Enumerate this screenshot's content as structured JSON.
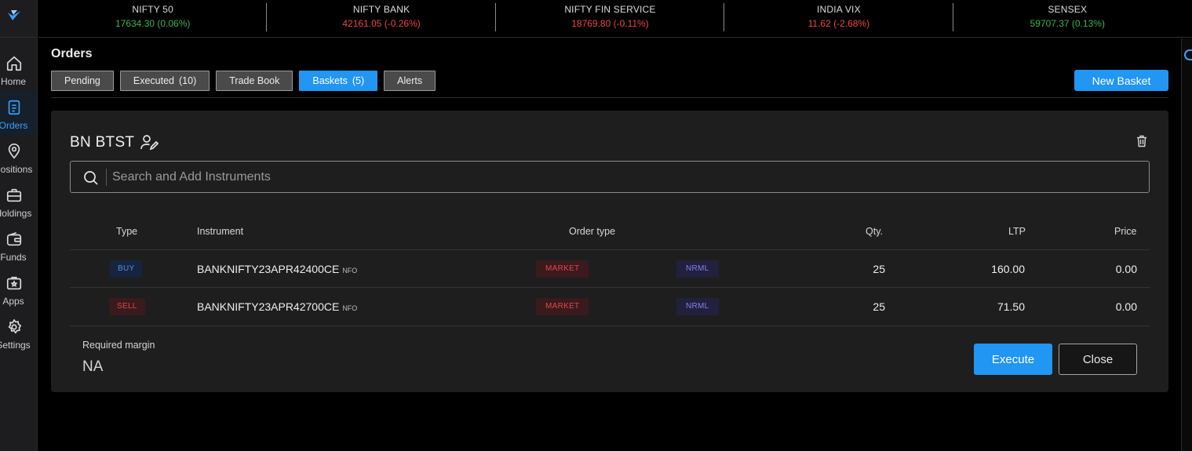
{
  "sidebar": {
    "items": [
      {
        "label": "Home",
        "icon": "home-icon"
      },
      {
        "label": "Orders",
        "icon": "orders-icon",
        "active": true
      },
      {
        "label": "Positions",
        "icon": "location-pin-icon"
      },
      {
        "label": "Holdings",
        "icon": "briefcase-icon"
      },
      {
        "label": "Funds",
        "icon": "wallet-icon"
      },
      {
        "label": "Apps",
        "icon": "apps-icon"
      },
      {
        "label": "Settings",
        "icon": "gear-icon"
      }
    ]
  },
  "ticker": [
    {
      "name": "NIFTY 50",
      "value": "17634.30 (0.06%)",
      "trend": "up"
    },
    {
      "name": "NIFTY BANK",
      "value": "42161.05 (-0.26%)",
      "trend": "down"
    },
    {
      "name": "NIFTY FIN SERVICE",
      "value": "18769.80 (-0.11%)",
      "trend": "down"
    },
    {
      "name": "INDIA VIX",
      "value": "11.62 (-2.68%)",
      "trend": "down"
    },
    {
      "name": "SENSEX",
      "value": "59707.37 (0.13%)",
      "trend": "up"
    }
  ],
  "page": {
    "title": "Orders",
    "new_basket_label": "New Basket"
  },
  "tabs": [
    {
      "label": "Pending",
      "count": ""
    },
    {
      "label": "Executed",
      "count": "(10)"
    },
    {
      "label": "Trade Book",
      "count": ""
    },
    {
      "label": "Baskets",
      "count": "(5)",
      "active": true
    },
    {
      "label": "Alerts",
      "count": ""
    }
  ],
  "basket": {
    "name": "BN BTST",
    "search_placeholder": "Search and Add Instruments",
    "columns": {
      "type": "Type",
      "instrument": "Instrument",
      "order_type": "Order type",
      "qty": "Qty.",
      "ltp": "LTP",
      "price": "Price"
    },
    "rows": [
      {
        "type": "BUY",
        "instrument": "BANKNIFTY23APR42400CE",
        "exchange": "NFO",
        "order_type": "MARKET",
        "product": "NRML",
        "qty": "25",
        "ltp": "160.00",
        "price": "0.00"
      },
      {
        "type": "SELL",
        "instrument": "BANKNIFTY23APR42700CE",
        "exchange": "NFO",
        "order_type": "MARKET",
        "product": "NRML",
        "qty": "25",
        "ltp": "71.50",
        "price": "0.00"
      }
    ],
    "margin_label": "Required margin",
    "margin_value": "NA",
    "execute_label": "Execute",
    "close_label": "Close"
  },
  "colors": {
    "accent": "#2196f3",
    "positive": "#3cb44b",
    "negative": "#ef4444"
  }
}
